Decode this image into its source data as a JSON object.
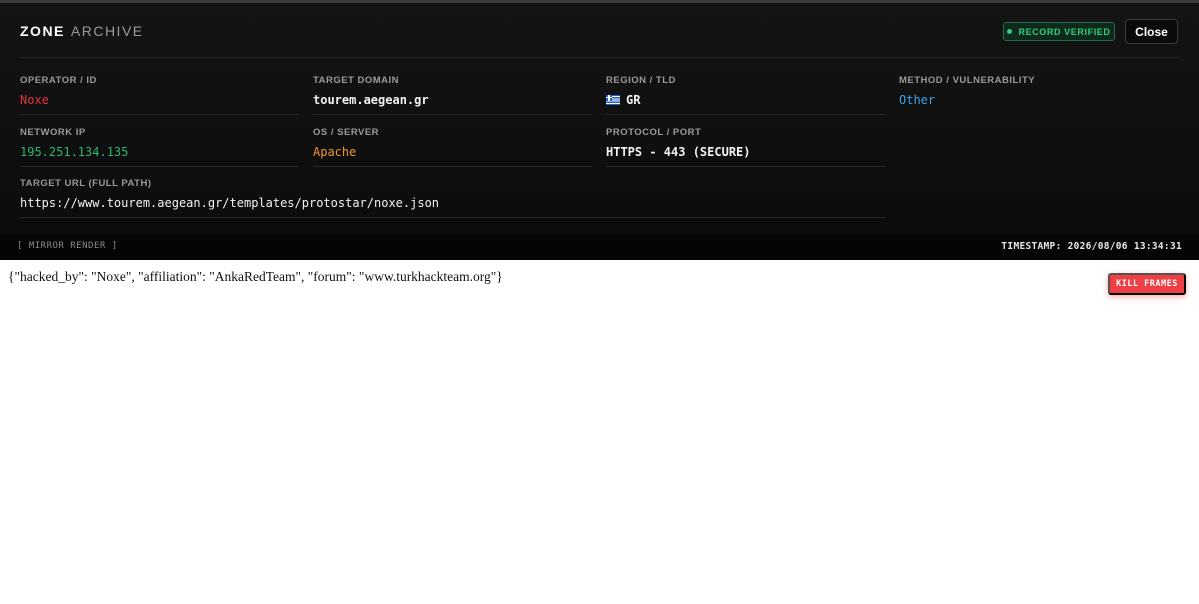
{
  "header": {
    "brand_primary": "ZONE",
    "brand_secondary": "ARCHIVE",
    "verified_label": "RECORD VERIFIED",
    "close_label": "Close"
  },
  "fields": {
    "operator": {
      "label": "OPERATOR / ID",
      "value": "Noxe"
    },
    "domain": {
      "label": "TARGET DOMAIN",
      "value": "tourem.aegean.gr"
    },
    "region": {
      "label": "REGION / TLD",
      "value": "GR",
      "flag_icon": "greece-flag-icon"
    },
    "method": {
      "label": "METHOD / VULNERABILITY",
      "value": "Other"
    },
    "ip": {
      "label": "NETWORK IP",
      "value": "195.251.134.135"
    },
    "os": {
      "label": "OS / SERVER",
      "value": "Apache"
    },
    "protocol": {
      "label": "PROTOCOL / PORT",
      "value": "HTTPS - 443 (SECURE)"
    },
    "url": {
      "label": "TARGET URL (FULL PATH)",
      "value": "https://www.tourem.aegean.gr/templates/protostar/noxe.json"
    }
  },
  "statusbar": {
    "left": "[ MIRROR RENDER ]",
    "timestamp": "TIMESTAMP: 2026/08/06 13:34:31"
  },
  "mirror": {
    "content": "{\"hacked_by\": \"Noxe\", \"affiliation\": \"AnkaRedTeam\", \"forum\": \"www.turkhackteam.org\"}",
    "kill_label": "KILL FRAMES"
  },
  "colors": {
    "operator": "#e5343b",
    "ip": "#2fb574",
    "os": "#f0952b",
    "method": "#3ba4ef",
    "verified": "#2fcf7f",
    "kill": "#ee3f44"
  }
}
